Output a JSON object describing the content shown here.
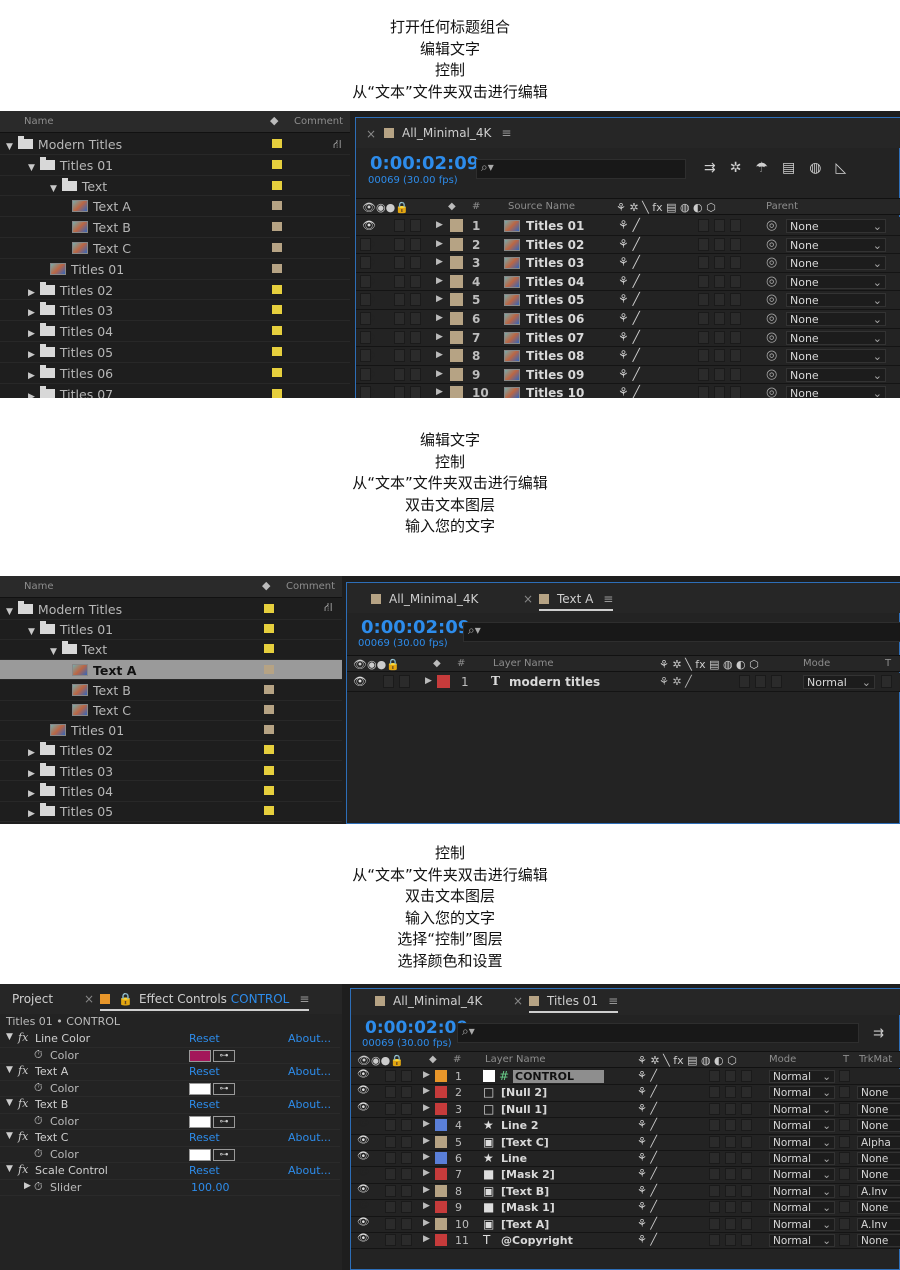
{
  "captions": {
    "c1": [
      "打开任何标题组合",
      "编辑文字",
      "控制",
      "从“文本”文件夹双击进行编辑"
    ],
    "c2": [
      "编辑文字",
      "控制",
      "从“文本”文件夹双击进行编辑",
      "双击文本图层",
      "输入您的文字"
    ],
    "c3": [
      "控制",
      "从“文本”文件夹双击进行编辑",
      "双击文本图层",
      "输入您的文字",
      "选择“控制”图层",
      "选择颜色和设置"
    ]
  },
  "colors": {
    "yellow": "#e6cf3d",
    "tan": "#b6a384",
    "red": "#c63b3b",
    "orange": "#e8962a",
    "white": "#ffffff",
    "blue_label": "#5a7fd8",
    "accent_blue": "#2d8ceb",
    "magenta": "#a3175a",
    "navy": "#2a1fa6"
  },
  "s1": {
    "project": {
      "col_name": "Name",
      "col_comment": "Comment",
      "rows": [
        {
          "label": "Modern Titles",
          "type": "folder-open",
          "indent": 0,
          "color": "yellow"
        },
        {
          "label": "Titles 01",
          "type": "folder-open",
          "indent": 1,
          "color": "yellow"
        },
        {
          "label": "Text",
          "type": "folder-open",
          "indent": 2,
          "color": "yellow"
        },
        {
          "label": "Text A",
          "type": "comp",
          "indent": 3,
          "color": "tan"
        },
        {
          "label": "Text B",
          "type": "comp",
          "indent": 3,
          "color": "tan"
        },
        {
          "label": "Text C",
          "type": "comp",
          "indent": 3,
          "color": "tan"
        },
        {
          "label": "Titles 01",
          "type": "comp",
          "indent": 2,
          "color": "tan"
        },
        {
          "label": "Titles 02",
          "type": "folder",
          "indent": 1,
          "color": "yellow"
        },
        {
          "label": "Titles 03",
          "type": "folder",
          "indent": 1,
          "color": "yellow"
        },
        {
          "label": "Titles 04",
          "type": "folder",
          "indent": 1,
          "color": "yellow"
        },
        {
          "label": "Titles 05",
          "type": "folder",
          "indent": 1,
          "color": "yellow"
        },
        {
          "label": "Titles 06",
          "type": "folder",
          "indent": 1,
          "color": "yellow"
        },
        {
          "label": "Titles 07",
          "type": "folder",
          "indent": 1,
          "color": "yellow"
        }
      ]
    },
    "timeline": {
      "tab": "All_Minimal_4K",
      "timecode": "0:00:02:09",
      "fps": "00069 (30.00 fps)",
      "search_placeholder": "⌕▾",
      "col_source": "Source Name",
      "col_parent": "Parent",
      "layers": [
        {
          "num": "1",
          "name": "Titles 01",
          "parent": "None"
        },
        {
          "num": "2",
          "name": "Titles 02",
          "parent": "None"
        },
        {
          "num": "3",
          "name": "Titles 03",
          "parent": "None"
        },
        {
          "num": "4",
          "name": "Titles 04",
          "parent": "None"
        },
        {
          "num": "5",
          "name": "Titles 05",
          "parent": "None"
        },
        {
          "num": "6",
          "name": "Titles 06",
          "parent": "None"
        },
        {
          "num": "7",
          "name": "Titles 07",
          "parent": "None"
        },
        {
          "num": "8",
          "name": "Titles 08",
          "parent": "None"
        },
        {
          "num": "9",
          "name": "Titles 09",
          "parent": "None"
        },
        {
          "num": "10",
          "name": "Titles 10",
          "parent": "None"
        }
      ]
    }
  },
  "s2": {
    "project": {
      "col_name": "Name",
      "col_comment": "Comment",
      "rows": [
        {
          "label": "Modern Titles",
          "type": "folder-open",
          "indent": 0,
          "color": "yellow"
        },
        {
          "label": "Titles 01",
          "type": "folder-open",
          "indent": 1,
          "color": "yellow"
        },
        {
          "label": "Text",
          "type": "folder-open",
          "indent": 2,
          "color": "yellow"
        },
        {
          "label": "Text A",
          "type": "comp",
          "indent": 3,
          "color": "tan",
          "selected": true
        },
        {
          "label": "Text B",
          "type": "comp",
          "indent": 3,
          "color": "tan"
        },
        {
          "label": "Text C",
          "type": "comp",
          "indent": 3,
          "color": "tan"
        },
        {
          "label": "Titles 01",
          "type": "comp",
          "indent": 2,
          "color": "tan"
        },
        {
          "label": "Titles 02",
          "type": "folder",
          "indent": 1,
          "color": "yellow"
        },
        {
          "label": "Titles 03",
          "type": "folder",
          "indent": 1,
          "color": "yellow"
        },
        {
          "label": "Titles 04",
          "type": "folder",
          "indent": 1,
          "color": "yellow"
        },
        {
          "label": "Titles 05",
          "type": "folder",
          "indent": 1,
          "color": "yellow"
        }
      ]
    },
    "timeline": {
      "tab1": "All_Minimal_4K",
      "tab2": "Text A",
      "timecode": "0:00:02:09",
      "fps": "00069 (30.00 fps)",
      "search_placeholder": "⌕▾",
      "col_layer": "Layer Name",
      "col_mode": "Mode",
      "col_t": "T",
      "layer": {
        "num": "1",
        "name": "modern titles",
        "mode": "Normal"
      }
    }
  },
  "s3": {
    "effects": {
      "tab_project": "Project",
      "tab_effects": "Effect Controls",
      "tab_effects_target": "CONTROL",
      "breadcrumb": "Titles 01 • CONTROL",
      "rows": [
        {
          "kind": "effect",
          "label": "Line Color",
          "reset": "Reset",
          "about": "About..."
        },
        {
          "kind": "prop",
          "label": "Color",
          "swatch": "magenta"
        },
        {
          "kind": "effect",
          "label": "Text A",
          "reset": "Reset",
          "about": "About..."
        },
        {
          "kind": "prop",
          "label": "Color",
          "swatch": "white"
        },
        {
          "kind": "effect",
          "label": "Text B",
          "reset": "Reset",
          "about": "About..."
        },
        {
          "kind": "prop",
          "label": "Color",
          "swatch": "white"
        },
        {
          "kind": "effect",
          "label": "Text C",
          "reset": "Reset",
          "about": "About..."
        },
        {
          "kind": "prop",
          "label": "Color",
          "swatch": "white"
        },
        {
          "kind": "effect",
          "label": "Scale Control",
          "reset": "Reset",
          "about": "About..."
        },
        {
          "kind": "slider",
          "label": "Slider",
          "value": "100.00"
        }
      ]
    },
    "timeline": {
      "tab1": "All_Minimal_4K",
      "tab2": "Titles 01",
      "timecode": "0:00:02:09",
      "fps": "00069 (30.00 fps)",
      "search_placeholder": "⌕▾",
      "col_layer": "Layer Name",
      "col_mode": "Mode",
      "col_t": "T",
      "col_trkmat": "TrkMat",
      "layers": [
        {
          "num": "1",
          "name": "CONTROL",
          "icon": "#",
          "label": "orange",
          "mode": "Normal",
          "trkmat": "",
          "selected": true
        },
        {
          "num": "2",
          "name": "[Null 2]",
          "icon": "□",
          "label": "red",
          "mode": "Normal",
          "trkmat": "None"
        },
        {
          "num": "3",
          "name": "[Null 1]",
          "icon": "□",
          "label": "red",
          "mode": "Normal",
          "trkmat": "None"
        },
        {
          "num": "4",
          "name": "Line 2",
          "icon": "★",
          "label": "blue_label",
          "mode": "Normal",
          "trkmat": "None"
        },
        {
          "num": "5",
          "name": "[Text C]",
          "icon": "▣",
          "label": "tan",
          "mode": "Normal",
          "trkmat": "Alpha"
        },
        {
          "num": "6",
          "name": "Line",
          "icon": "★",
          "label": "blue_label",
          "mode": "Normal",
          "trkmat": "None"
        },
        {
          "num": "7",
          "name": "[Mask 2]",
          "icon": "■",
          "label": "red",
          "mode": "Normal",
          "trkmat": "None"
        },
        {
          "num": "8",
          "name": "[Text B]",
          "icon": "▣",
          "label": "tan",
          "mode": "Normal",
          "trkmat": "A.Inv"
        },
        {
          "num": "9",
          "name": "[Mask 1]",
          "icon": "■",
          "label": "red",
          "mode": "Normal",
          "trkmat": "None"
        },
        {
          "num": "10",
          "name": "[Text A]",
          "icon": "▣",
          "label": "tan",
          "mode": "Normal",
          "trkmat": "A.Inv"
        },
        {
          "num": "11",
          "name": "@Copyright",
          "icon": "T",
          "label": "red",
          "mode": "Normal",
          "trkmat": "None"
        }
      ]
    }
  }
}
